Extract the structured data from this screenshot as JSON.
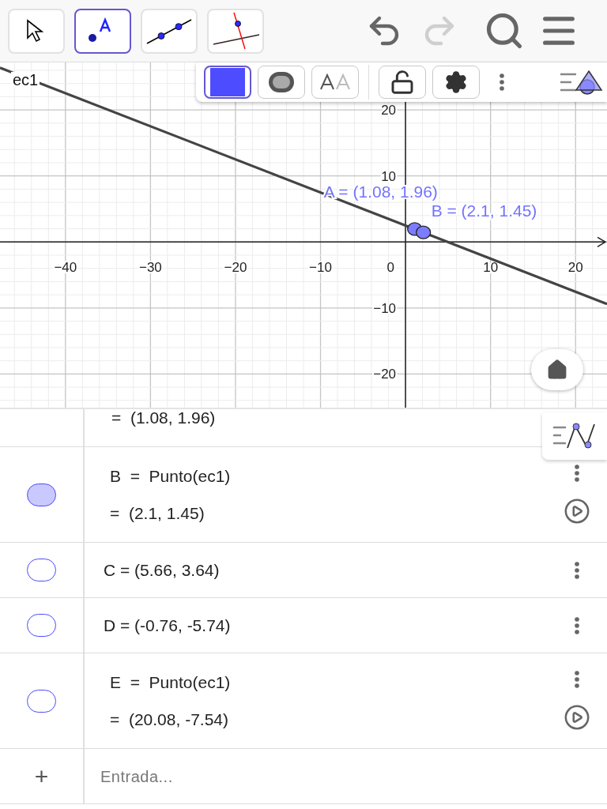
{
  "toolbar": {
    "tools": [
      {
        "kind": "move",
        "selected": false
      },
      {
        "kind": "point",
        "selected": true
      },
      {
        "kind": "line",
        "selected": false
      },
      {
        "kind": "perpendicular",
        "selected": false
      }
    ],
    "actions": [
      {
        "kind": "undo",
        "disabled": false
      },
      {
        "kind": "redo",
        "disabled": true
      },
      {
        "kind": "search",
        "disabled": false
      },
      {
        "kind": "menu",
        "disabled": false
      }
    ]
  },
  "style_bar": {
    "color": "#4d4dff",
    "buttons": [
      {
        "kind": "color",
        "selected": true
      },
      {
        "kind": "point-style",
        "selected": false
      },
      {
        "kind": "label",
        "selected": false
      },
      {
        "kind": "lock",
        "selected": false
      },
      {
        "kind": "settings",
        "selected": false
      },
      {
        "kind": "more",
        "selected": false
      },
      {
        "kind": "view",
        "selected": false
      }
    ]
  },
  "graphics": {
    "origin_label": "0",
    "chart_data": {
      "type": "line",
      "grid": true,
      "x": [
        -47.7,
        23.7
      ],
      "series": [
        {
          "name": "ec1",
          "color": "#444444",
          "values": [
            26.4,
            -9.4
          ]
        }
      ],
      "xlim": [
        -47.7,
        23.7
      ],
      "ylim": [
        -25.1,
        27.2
      ],
      "xticks": [
        {
          "value": -40,
          "label": "−40"
        },
        {
          "value": -30,
          "label": "−30"
        },
        {
          "value": -20,
          "label": "−20"
        },
        {
          "value": -10,
          "label": "−10"
        },
        {
          "value": 10,
          "label": "10"
        },
        {
          "value": 20,
          "label": "20"
        }
      ],
      "yticks": [
        {
          "value": 20,
          "label": "20"
        },
        {
          "value": 10,
          "label": "10"
        },
        {
          "value": -10,
          "label": "−10"
        },
        {
          "value": -20,
          "label": "−20"
        }
      ],
      "annotations": [
        {
          "text": "A = (1.08, 1.96)",
          "x": 1.08,
          "y": 1.96
        },
        {
          "text": "B = (2.1, 1.45)",
          "x": 2.1,
          "y": 1.45
        }
      ]
    }
  },
  "algebra": {
    "partial_row": {
      "value": "=  (1.08, 1.96)"
    },
    "rows": [
      {
        "definition": "B  =  Punto(ec1)",
        "value": "=  (2.1, 1.45)",
        "shown": true,
        "animatable": true
      },
      {
        "definition": "C = (5.66, 3.64)",
        "shown": false,
        "animatable": false
      },
      {
        "definition": "D = (-0.76, -5.74)",
        "shown": false,
        "animatable": false
      },
      {
        "definition": "E  =  Punto(ec1)",
        "value": "=  (20.08, -7.54)",
        "shown": false,
        "animatable": true
      }
    ],
    "input": {
      "symbol": "+",
      "placeholder": "Entrada..."
    }
  }
}
